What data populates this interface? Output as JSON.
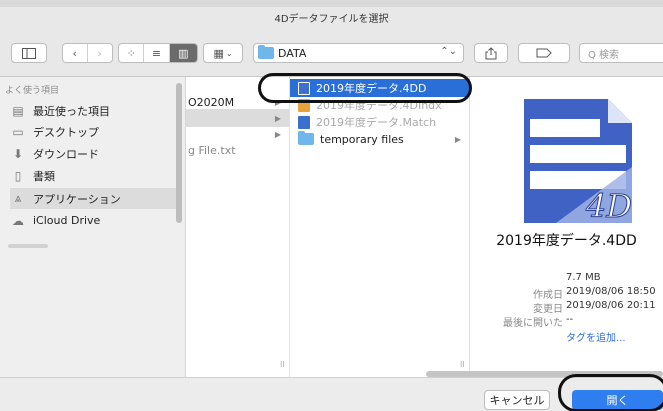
{
  "dialog": {
    "title": "4Dデータファイルを選択"
  },
  "toolbar": {
    "path": "DATA",
    "search_placeholder": "Q 検索"
  },
  "sidebar": {
    "section_label": "よく使う項目",
    "items": [
      {
        "label": "最近使った項目",
        "icon": "recent-icon"
      },
      {
        "label": "デスクトップ",
        "icon": "desktop-icon"
      },
      {
        "label": "ダウンロード",
        "icon": "download-icon"
      },
      {
        "label": "書類",
        "icon": "documents-icon"
      },
      {
        "label": "アプリケーション",
        "icon": "applications-icon"
      },
      {
        "label": "iCloud Drive",
        "icon": "cloud-icon"
      }
    ]
  },
  "column1": {
    "items": [
      {
        "label": "O2020M"
      },
      {
        "label": ""
      },
      {
        "label": ""
      },
      {
        "label": "g File.txt"
      }
    ]
  },
  "column2": {
    "items": [
      {
        "label": "2019年度データ.4DD",
        "state": "highlighted"
      },
      {
        "label": "2019年度データ.4DIndx",
        "state": "faded"
      },
      {
        "label": "2019年度データ.Match",
        "state": "faded"
      },
      {
        "label": "temporary files",
        "state": "normal"
      }
    ]
  },
  "preview": {
    "filename": "2019年度データ.4DD",
    "size": "7.7 MB",
    "created_label": "作成日",
    "created": "2019/08/06 18:50",
    "modified_label": "変更日",
    "modified": "2019/08/06 20:11",
    "last_opened_label": "最後に開いた",
    "last_opened": "--",
    "add_tag": "タグを追加..."
  },
  "footer": {
    "cancel_label": "キャンセル",
    "open_label": "開く"
  },
  "colors": {
    "accent": "#2a6fd8",
    "button_primary": "#2f7ef0",
    "folder": "#6fb6ea"
  }
}
